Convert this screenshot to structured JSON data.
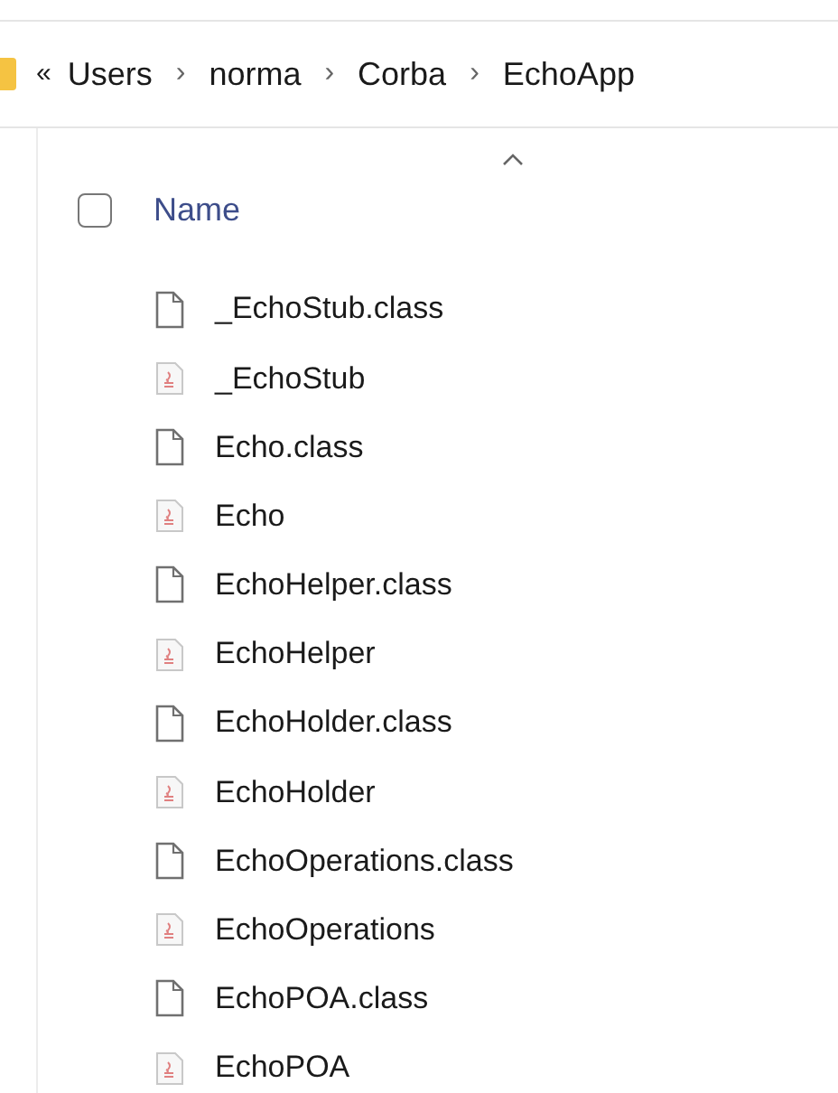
{
  "breadcrumb": {
    "overflow": "«",
    "items": [
      "Users",
      "norma",
      "Corba",
      "EchoApp"
    ],
    "separator": "›"
  },
  "header": {
    "checked": false,
    "name_column": "Name",
    "sort_ascending": true
  },
  "files": [
    {
      "name": "_EchoStub.class",
      "kind": "blank"
    },
    {
      "name": "_EchoStub",
      "kind": "java"
    },
    {
      "name": "Echo.class",
      "kind": "blank"
    },
    {
      "name": "Echo",
      "kind": "java"
    },
    {
      "name": "EchoHelper.class",
      "kind": "blank"
    },
    {
      "name": "EchoHelper",
      "kind": "java"
    },
    {
      "name": "EchoHolder.class",
      "kind": "blank"
    },
    {
      "name": "EchoHolder",
      "kind": "java"
    },
    {
      "name": "EchoOperations.class",
      "kind": "blank"
    },
    {
      "name": "EchoOperations",
      "kind": "java"
    },
    {
      "name": "EchoPOA.class",
      "kind": "blank"
    },
    {
      "name": "EchoPOA",
      "kind": "java"
    }
  ]
}
